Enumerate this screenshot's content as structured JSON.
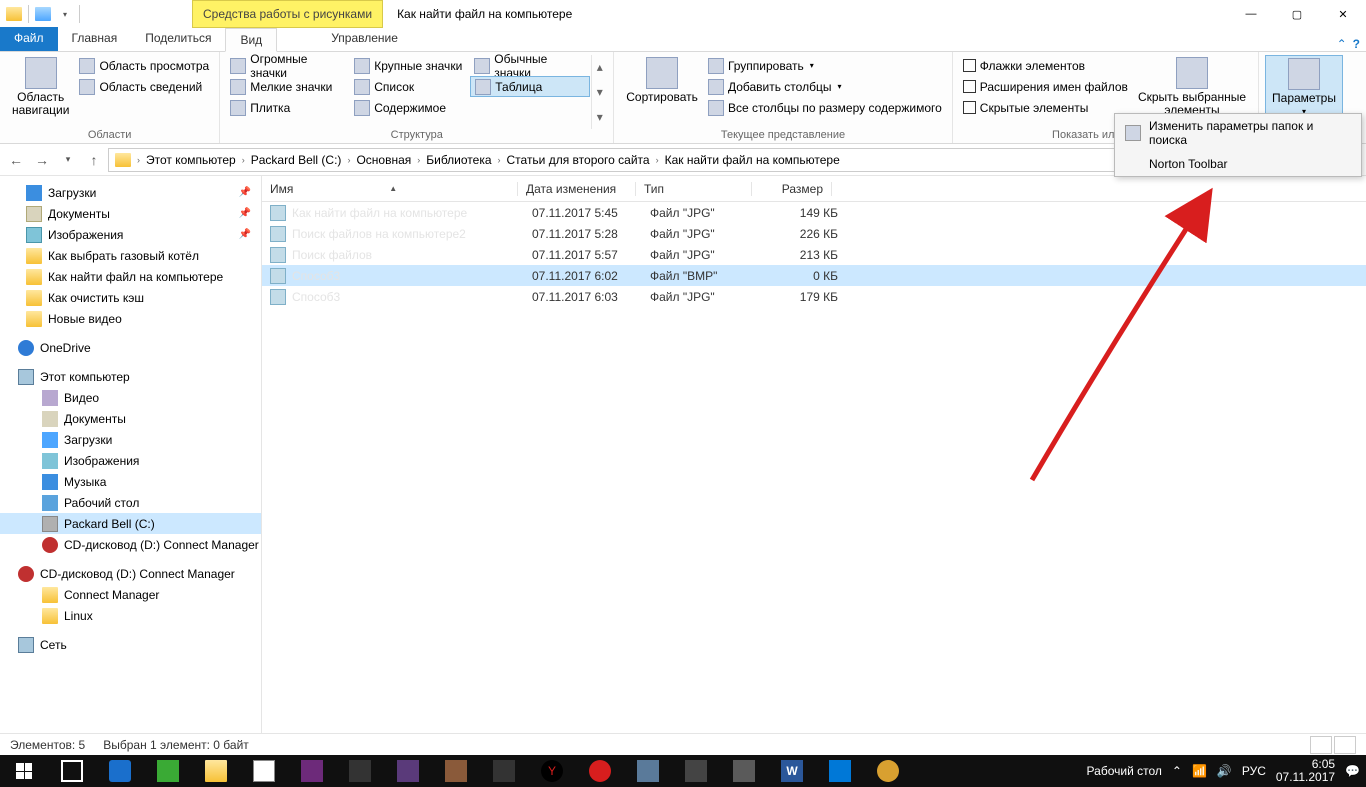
{
  "title": {
    "context_tab": "Средства работы с рисунками",
    "window": "Как найти файл на компьютере"
  },
  "tabs": {
    "file": "Файл",
    "home": "Главная",
    "share": "Поделиться",
    "view": "Вид",
    "manage": "Управление"
  },
  "ribbon": {
    "panes_group": "Области",
    "nav_pane": "Область\nнавигации",
    "preview_pane": "Область просмотра",
    "details_pane": "Область сведений",
    "layout_group": "Структура",
    "extra_large": "Огромные значки",
    "large": "Крупные значки",
    "normal": "Обычные значки",
    "small": "Мелкие значки",
    "list": "Список",
    "table": "Таблица",
    "tiles": "Плитка",
    "content": "Содержимое",
    "current_group": "Текущее представление",
    "sort": "Сортировать",
    "group_by": "Группировать",
    "add_cols": "Добавить столбцы",
    "all_cols": "Все столбцы по размеру содержимого",
    "show_hide_group": "Показать или скрыть",
    "checkboxes": "Флажки элементов",
    "extensions": "Расширения имен файлов",
    "hidden": "Скрытые элементы",
    "hide_selected": "Скрыть выбранные\nэлементы",
    "options": "Параметры"
  },
  "dropdown": {
    "change_opts": "Изменить параметры папок и поиска",
    "norton": "Norton Toolbar"
  },
  "breadcrumbs": [
    "Этот компьютер",
    "Packard Bell (C:)",
    "Основная",
    "Библиотека",
    "Статьи для второго сайта",
    "Как найти файл на компьютере"
  ],
  "tree": {
    "quick": {
      "downloads": "Загрузки",
      "documents": "Документы",
      "pictures": "Изображения",
      "boiler": "Как выбрать газовый котёл",
      "findfile": "Как найти файл на компьютере",
      "clearcache": "Как очистить кэш",
      "newvideos": "Новые видео"
    },
    "onedrive": "OneDrive",
    "thispc": "Этот компьютер",
    "pc": {
      "video": "Видео",
      "documents": "Документы",
      "downloads": "Загрузки",
      "pictures": "Изображения",
      "music": "Музыка",
      "desktop": "Рабочий стол",
      "drive_c": "Packard Bell (C:)",
      "drive_d": "CD-дисковод (D:) Connect Manager"
    },
    "cd_root": "CD-дисковод (D:) Connect Manager",
    "cd_sub1": "Connect Manager",
    "cd_sub2": "Linux",
    "network": "Сеть"
  },
  "columns": {
    "name": "Имя",
    "date": "Дата изменения",
    "type": "Тип",
    "size": "Размер"
  },
  "files": [
    {
      "name": "Как найти файл на компьютере",
      "date": "07.11.2017 5:45",
      "type": "Файл \"JPG\"",
      "size": "149 КБ",
      "faded": true
    },
    {
      "name": "Поиск файлов на компьютере2",
      "date": "07.11.2017 5:28",
      "type": "Файл \"JPG\"",
      "size": "226 КБ",
      "faded": true
    },
    {
      "name": "Поиск файлов",
      "date": "07.11.2017 5:57",
      "type": "Файл \"JPG\"",
      "size": "213 КБ",
      "faded": true
    },
    {
      "name": "Способ3",
      "date": "07.11.2017 6:02",
      "type": "Файл \"BMP\"",
      "size": "0 КБ",
      "sel": true,
      "faded": true
    },
    {
      "name": "Способ3",
      "date": "07.11.2017 6:03",
      "type": "Файл \"JPG\"",
      "size": "179 КБ",
      "faded": true
    }
  ],
  "status": {
    "count": "Элементов: 5",
    "selection": "Выбран 1 элемент: 0 байт"
  },
  "taskbar": {
    "desktop": "Рабочий стол",
    "lang": "РУС",
    "time": "6:05",
    "date": "07.11.2017"
  }
}
